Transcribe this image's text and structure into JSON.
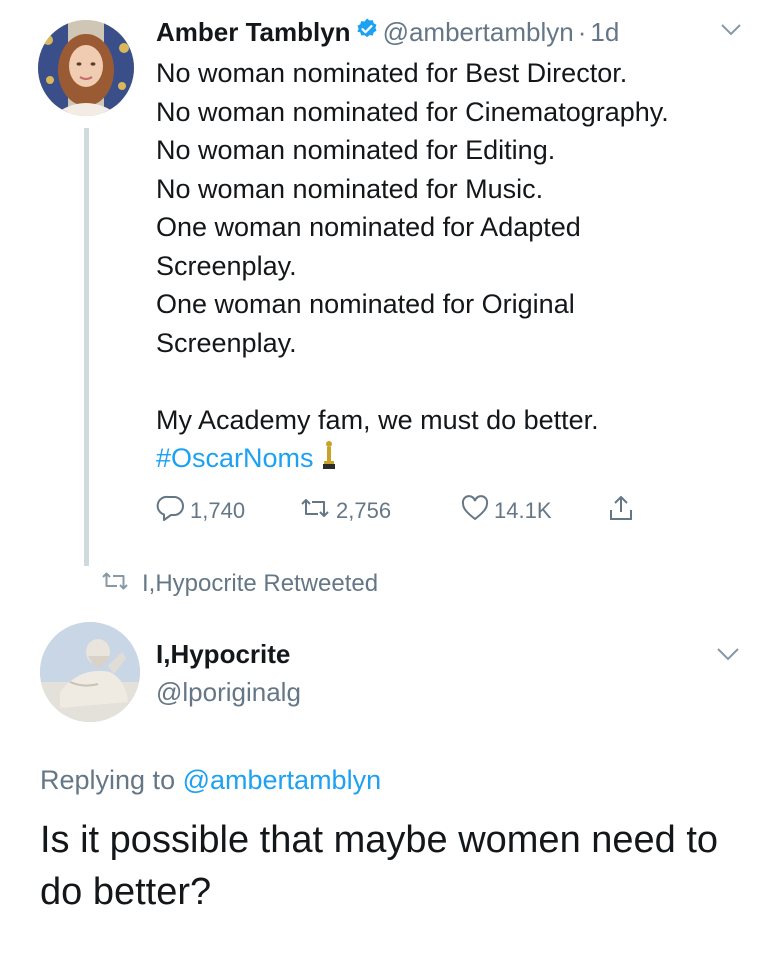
{
  "tweet1": {
    "author_name": "Amber Tamblyn",
    "handle": "@ambertamblyn",
    "separator": "·",
    "time": "1d",
    "lines": [
      "No woman nominated for Best Director.",
      "No woman nominated for Cinematography.",
      "No woman nominated for Editing.",
      "No woman nominated for Music.",
      "One woman nominated for Adapted",
      "Screenplay.",
      "One woman nominated for Original",
      "Screenplay.",
      "",
      "My Academy fam, we must do better."
    ],
    "hashtag": "#OscarNoms",
    "stats": {
      "replies": "1,740",
      "retweets": "2,756",
      "likes": "14.1K"
    }
  },
  "retweet_context": "I,Hypocrite Retweeted",
  "tweet2": {
    "author_name": "I,Hypocrite",
    "handle": "@lporiginalg",
    "replying_label": "Replying to",
    "replying_handle": "@ambertamblyn",
    "text": "Is it possible that maybe women need to do better?"
  },
  "colors": {
    "link": "#1da1f2",
    "muted": "#657786",
    "text": "#14171a",
    "verified": "#1da1f2"
  },
  "icons": {
    "reply": "reply-icon",
    "retweet": "retweet-icon",
    "like": "heart-icon",
    "share": "share-icon",
    "verified": "verified-badge-icon",
    "menu": "chevron-down-icon",
    "trophy": "oscar-trophy-emoji"
  }
}
